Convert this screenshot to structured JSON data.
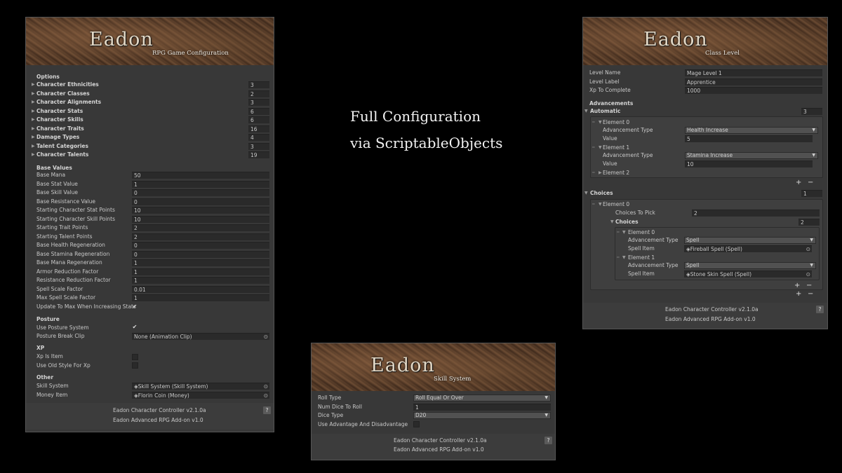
{
  "center_text": {
    "line1": "Full Configuration",
    "line2": "via ScriptableObjects"
  },
  "logo_text": "Eadon",
  "config_panel": {
    "subtitle": "RPG Game Configuration",
    "options_header": "Options",
    "options": [
      {
        "label": "Character Ethnicities",
        "value": "3"
      },
      {
        "label": "Character Classes",
        "value": "2"
      },
      {
        "label": "Character Alignments",
        "value": "3"
      },
      {
        "label": "Character Stats",
        "value": "6"
      },
      {
        "label": "Character Skills",
        "value": "6"
      },
      {
        "label": "Character Traits",
        "value": "16"
      },
      {
        "label": "Damage Types",
        "value": "4"
      },
      {
        "label": "Talent Categories",
        "value": "3"
      },
      {
        "label": "Character Talents",
        "value": "19"
      }
    ],
    "base_header": "Base Values",
    "base": [
      {
        "label": "Base Mana",
        "value": "50"
      },
      {
        "label": "Base Stat Value",
        "value": "1"
      },
      {
        "label": "Base Skill Value",
        "value": "0"
      },
      {
        "label": "Base Resistance Value",
        "value": "0"
      },
      {
        "label": "Starting Character Stat Points",
        "value": "10"
      },
      {
        "label": "Starting Character Skill Points",
        "value": "10"
      },
      {
        "label": "Starting Trait Points",
        "value": "2"
      },
      {
        "label": "Starting Talent Points",
        "value": "2"
      },
      {
        "label": "Base Health Regeneration",
        "value": "0"
      },
      {
        "label": "Base Stamina Regeneration",
        "value": "0"
      },
      {
        "label": "Base Mana Regeneration",
        "value": "1"
      },
      {
        "label": "Armor Reduction Factor",
        "value": "1"
      },
      {
        "label": "Resistance Reduction Factor",
        "value": "1"
      },
      {
        "label": "Spell Scale Factor",
        "value": "0.01"
      },
      {
        "label": "Max Spell Scale Factor",
        "value": "1"
      }
    ],
    "update_to_max_label": "Update To Max When Increasing Stats",
    "posture_header": "Posture",
    "use_posture_label": "Use Posture System",
    "posture_break_label": "Posture Break Clip",
    "posture_break_value": "None (Animation Clip)",
    "xp_header": "XP",
    "xp_is_item_label": "Xp Is Item",
    "old_style_label": "Use Old Style For Xp",
    "other_header": "Other",
    "skill_system_label": "Skill System",
    "skill_system_value": "Skill System (Skill System)",
    "money_item_label": "Money Item",
    "money_item_value": "Florin Coin (Money)",
    "footer1": "Eadon Character Controller v2.1.0a",
    "footer2": "Eadon Advanced RPG Add-on v1.0",
    "help": "?"
  },
  "skill_panel": {
    "subtitle": "Skill System",
    "roll_type_label": "Roll Type",
    "roll_type_value": "Roll Equal Or Over",
    "num_dice_label": "Num Dice To Roll",
    "num_dice_value": "1",
    "dice_type_label": "Dice Type",
    "dice_type_value": "D20",
    "advantage_label": "Use Advantage And Disadvantage",
    "footer1": "Eadon Character Controller v2.1.0a",
    "footer2": "Eadon Advanced RPG Add-on v1.0",
    "help": "?"
  },
  "class_panel": {
    "subtitle": "Class Level",
    "level_name_label": "Level Name",
    "level_name_value": "Mage Level 1",
    "level_label_label": "Level Label",
    "level_label_value": "Apprentice",
    "xp_label": "Xp To Complete",
    "xp_value": "1000",
    "advancements_header": "Advancements",
    "automatic_label": "Automatic",
    "automatic_count": "3",
    "element0": "Element 0",
    "element1": "Element 1",
    "element2": "Element 2",
    "adv_type_label": "Advancement Type",
    "value_label": "Value",
    "auto_e0_type": "Health Increase",
    "auto_e0_value": "5",
    "auto_e1_type": "Stamina Increase",
    "auto_e1_value": "10",
    "choices_label": "Choices",
    "choices_count": "1",
    "choices_to_pick_label": "Choices To Pick",
    "choices_to_pick_value": "2",
    "inner_choices_count": "2",
    "spell_type": "Spell",
    "spell_item_label": "Spell Item",
    "spell_item_0": "Fireball Spell (Spell)",
    "spell_item_1": "Stone Skin Spell (Spell)",
    "plus": "+",
    "minus": "−",
    "footer1": "Eadon Character Controller v2.1.0a",
    "footer2": "Eadon Advanced RPG Add-on v1.0",
    "help": "?"
  }
}
